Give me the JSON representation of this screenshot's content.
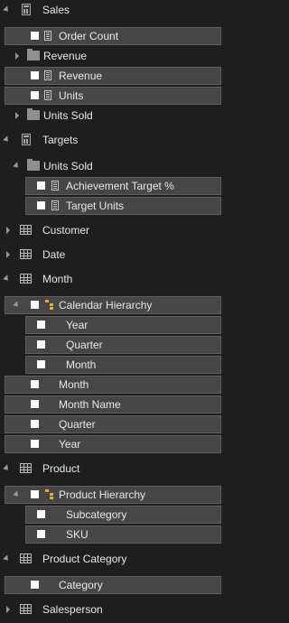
{
  "fields": {
    "sales": "Sales",
    "order_count": "Order Count",
    "revenue_folder": "Revenue",
    "revenue": "Revenue",
    "units": "Units",
    "units_sold_folder": "Units Sold",
    "targets": "Targets",
    "targets_units_sold": "Units Sold",
    "achievement_target": "Achievement Target %",
    "target_units": "Target Units",
    "customer": "Customer",
    "date": "Date",
    "month": "Month",
    "calendar_hierarchy": "Calendar Hierarchy",
    "year_level": "Year",
    "quarter_level": "Quarter",
    "month_level": "Month",
    "month_col": "Month",
    "month_name": "Month Name",
    "quarter_col": "Quarter",
    "year_col": "Year",
    "product": "Product",
    "product_hierarchy": "Product Hierarchy",
    "subcategory": "Subcategory",
    "sku": "SKU",
    "product_category": "Product Category",
    "category": "Category",
    "salesperson": "Salesperson"
  },
  "colors": {
    "background": "#1e1e1e",
    "row_highlight": "#464646",
    "checkbox": "#ffffff",
    "hierarchy_icon": "#e0b030"
  }
}
